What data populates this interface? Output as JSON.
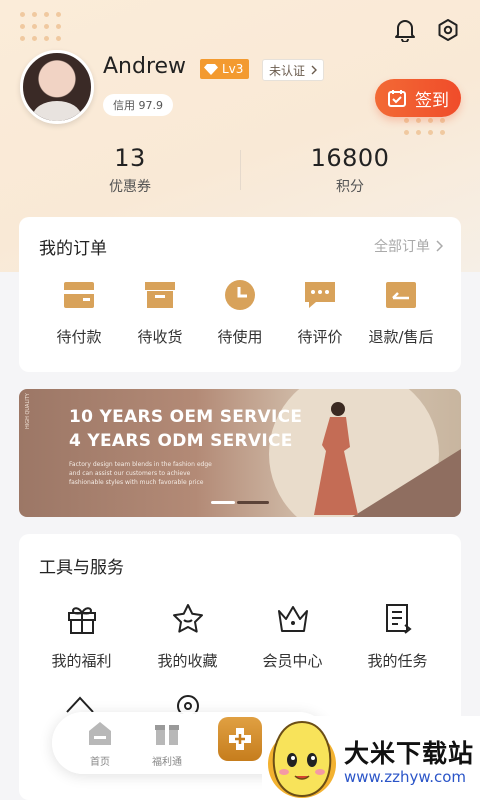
{
  "profile": {
    "username": "Andrew",
    "level": "Lv3",
    "verify_status": "未认证",
    "credit": "信用 97.9"
  },
  "signin": {
    "label": "签到"
  },
  "stats": [
    {
      "value": "13",
      "label": "优惠券"
    },
    {
      "value": "16800",
      "label": "积分"
    }
  ],
  "orders": {
    "title": "我的订单",
    "all_label": "全部订单",
    "items": [
      {
        "label": "待付款",
        "icon": "wallet-icon"
      },
      {
        "label": "待收货",
        "icon": "box-icon"
      },
      {
        "label": "待使用",
        "icon": "clock-icon"
      },
      {
        "label": "待评价",
        "icon": "comment-icon"
      },
      {
        "label": "退款/售后",
        "icon": "refund-icon"
      }
    ]
  },
  "banner": {
    "headline1": "10 YEARS OEM SERVICE",
    "headline2": "4 YEARS ODM SERVICE",
    "body": "Factory design team blends in the fashion edge and can assist our customers to achieve fashionable styles with much favorable price",
    "side_text": "HIGH QUALITY"
  },
  "tools": {
    "title": "工具与服务",
    "items": [
      {
        "label": "我的福利",
        "icon": "gift-icon"
      },
      {
        "label": "我的收藏",
        "icon": "star-icon"
      },
      {
        "label": "会员中心",
        "icon": "crown-icon"
      },
      {
        "label": "我的任务",
        "icon": "task-icon"
      }
    ]
  },
  "tabbar": {
    "items": [
      {
        "label": "首页",
        "icon": "home-icon"
      },
      {
        "label": "福利通",
        "icon": "gift-tab-icon"
      }
    ]
  },
  "watermark": {
    "title": "大米下载站",
    "url": "www.zzhyw.com"
  },
  "colors": {
    "accent": "#f04c2a",
    "order_icon": "#d8a25a",
    "level_badge": "#f39a2f"
  }
}
